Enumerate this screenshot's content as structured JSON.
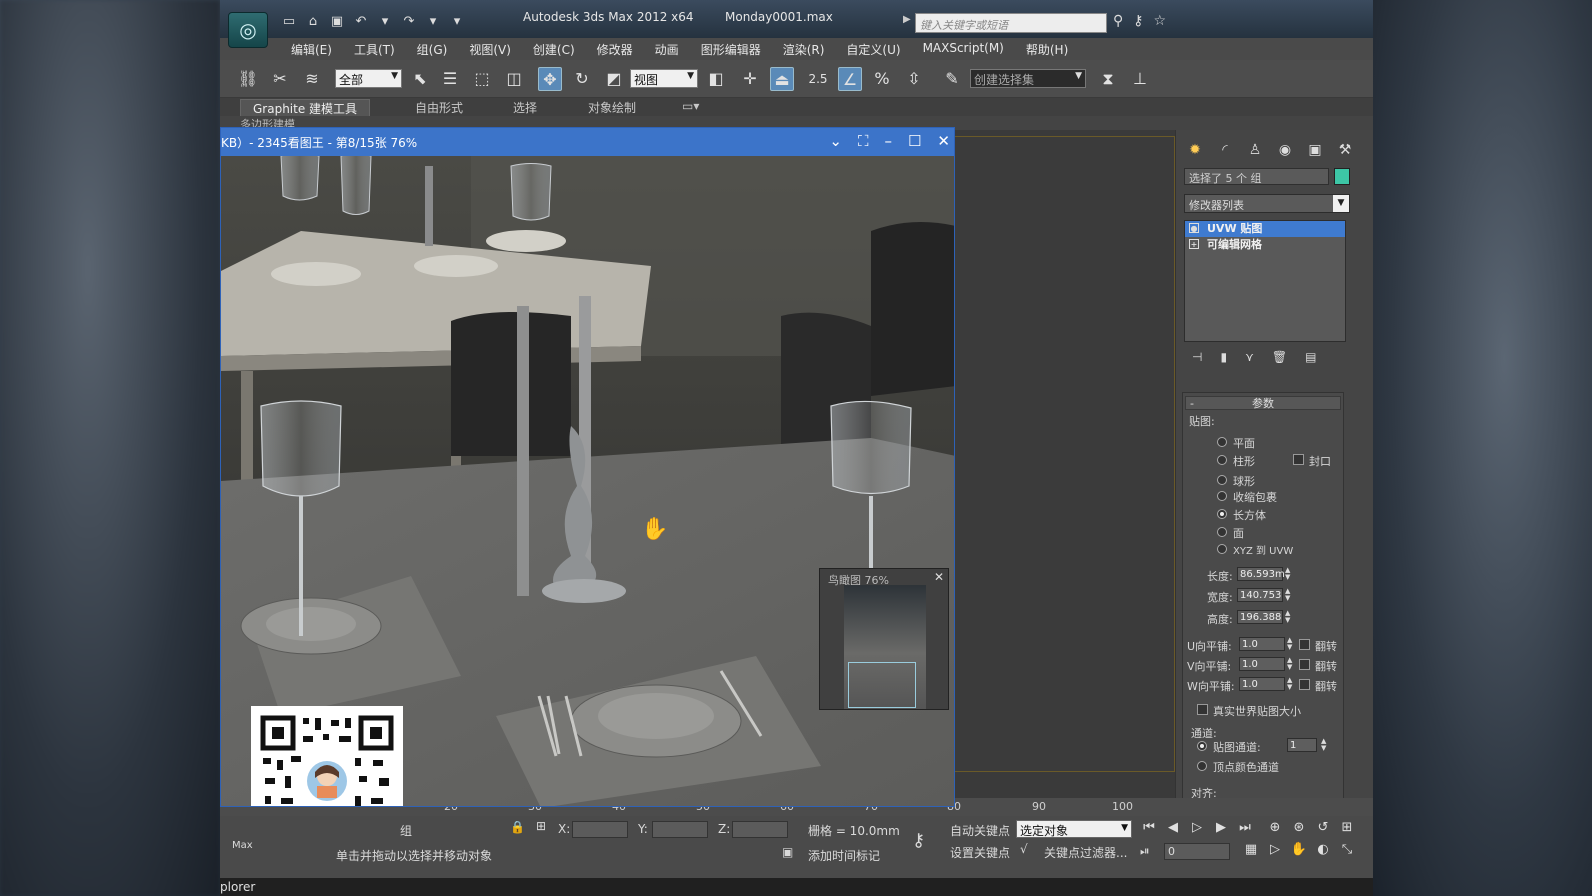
{
  "title_bar": {
    "app_title": "Autodesk 3ds Max  2012 x64",
    "document": "Monday0001.max",
    "search_placeholder": "键入关键字或短语"
  },
  "menu": [
    "编辑(E)",
    "工具(T)",
    "组(G)",
    "视图(V)",
    "创建(C)",
    "修改器",
    "动画",
    "图形编辑器",
    "渲染(R)",
    "自定义(U)",
    "MAXScript(M)",
    "帮助(H)"
  ],
  "toolbar": {
    "selection_filter": "全部",
    "ref_coord": "视图",
    "number_label": "2.5",
    "named_selection": "创建选择集"
  },
  "ribbon": {
    "tabs": [
      "Graphite 建模工具",
      "自由形式",
      "选择",
      "对象绘制"
    ],
    "sub_label": "多边形建模"
  },
  "image_viewer": {
    "title": "KB）- 2345看图王 - 第8/15张 76%",
    "birdseye_label": "鸟瞰图 76%"
  },
  "command_panel": {
    "selection_label": "选择了 5 个 组",
    "modifier_list": "修改器列表",
    "stack": [
      "UVW 贴图",
      "可编辑网格"
    ],
    "rollout_title": "参数",
    "mapping_label": "贴图:",
    "mapping_options": [
      "平面",
      "柱形",
      "球形",
      "收缩包裹",
      "长方体",
      "面",
      "XYZ 到 UVW"
    ],
    "selected_mapping": "长方体",
    "cap_label": "封口",
    "length_label": "长度:",
    "length_value": "86.593m",
    "width_label": "宽度:",
    "width_value": "140.753",
    "height_label": "高度:",
    "height_value": "196.388",
    "u_tile_label": "U向平铺:",
    "u_tile_value": "1.0",
    "v_tile_label": "V向平铺:",
    "v_tile_value": "1.0",
    "w_tile_label": "W向平铺:",
    "w_tile_value": "1.0",
    "flip_label": "翻转",
    "real_world_label": "真实世界贴图大小",
    "channel_group": "通道:",
    "map_channel_label": "贴图通道:",
    "map_channel_value": "1",
    "vertex_color_label": "顶点颜色通道",
    "align_label": "对齐:"
  },
  "timeline": {
    "ticks": [
      "20",
      "30",
      "40",
      "50",
      "60",
      "70",
      "80",
      "90",
      "100"
    ]
  },
  "status": {
    "group_label": "组",
    "prompt": "单击并拖动以选择并移动对象",
    "x_label": "X:",
    "y_label": "Y:",
    "z_label": "Z:",
    "grid": "栅格 = 10.0mm",
    "auto_key": "自动关键点",
    "set_key": "设置关键点",
    "key_mode": "选定对象",
    "key_filters": "关键点过滤器...",
    "add_time_tag": "添加时间标记",
    "frame": "0",
    "maxscript_mini": "Max",
    "explorer": "plorer"
  },
  "colors": {
    "viewer_title": "#3c74c9",
    "object_color": "#3dc6a6",
    "stack_selected": "#3f7bd0"
  }
}
